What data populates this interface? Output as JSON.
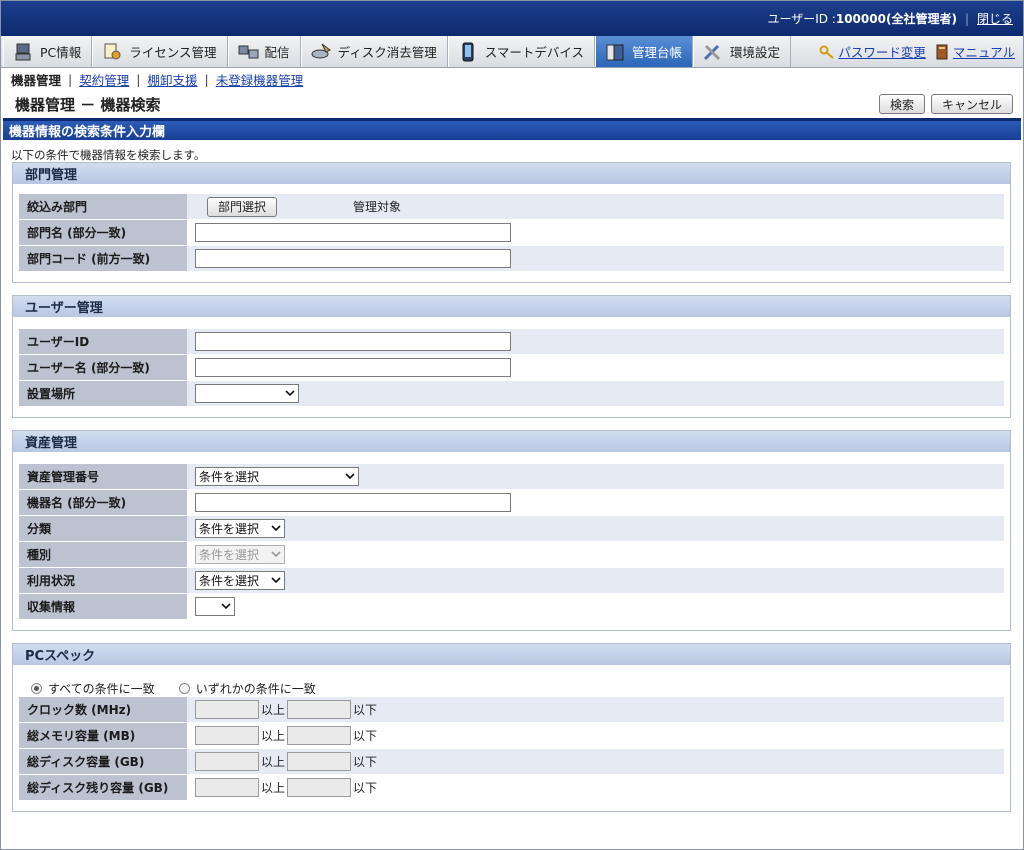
{
  "header": {
    "user_label": "ユーザーID : ",
    "user_value": "100000(全社管理者)",
    "close_link": "閉じる"
  },
  "nav": {
    "tabs": [
      {
        "label": "PC情報",
        "icon": "pc-icon"
      },
      {
        "label": "ライセンス管理",
        "icon": "license-icon"
      },
      {
        "label": "配信",
        "icon": "delivery-icon"
      },
      {
        "label": "ディスク消去管理",
        "icon": "disk-erase-icon"
      },
      {
        "label": "スマートデバイス",
        "icon": "smart-device-icon"
      },
      {
        "label": "管理台帳",
        "icon": "ledger-icon"
      },
      {
        "label": "環境設定",
        "icon": "settings-icon"
      }
    ],
    "password_link": "パスワード変更",
    "manual_link": "マニュアル"
  },
  "subnav": {
    "current": "機器管理",
    "links": [
      "契約管理",
      "棚卸支援",
      "未登録機器管理"
    ]
  },
  "page": {
    "title": "機器管理 － 機器検索",
    "search_button": "検索",
    "cancel_button": "キャンセル",
    "section_title": "機器情報の検索条件入力欄",
    "intro": "以下の条件で機器情報を検索します。"
  },
  "dept": {
    "title": "部門管理",
    "filter_label": "絞込み部門",
    "select_button": "部門選択",
    "target_text": "管理対象",
    "name_label": "部門名 (部分一致)",
    "code_label": "部門コード (前方一致)"
  },
  "user": {
    "title": "ユーザー管理",
    "id_label": "ユーザーID",
    "name_label": "ユーザー名 (部分一致)",
    "location_label": "設置場所",
    "location_value": ""
  },
  "asset": {
    "title": "資産管理",
    "number_label": "資産管理番号",
    "number_value": "条件を選択",
    "device_label": "機器名 (部分一致)",
    "class_label": "分類",
    "class_value": "条件を選択",
    "type_label": "種別",
    "type_value": "条件を選択",
    "usage_label": "利用状況",
    "usage_value": "条件を選択",
    "collect_label": "収集情報",
    "collect_value": ""
  },
  "spec": {
    "title": "PCスペック",
    "radio_all": "すべての条件に一致",
    "radio_any": "いずれかの条件に一致",
    "above": "以上",
    "below": "以下",
    "rows": [
      "クロック数 (MHz)",
      "総メモリ容量 (MB)",
      "総ディスク容量 (GB)",
      "総ディスク残り容量 (GB)"
    ]
  }
}
